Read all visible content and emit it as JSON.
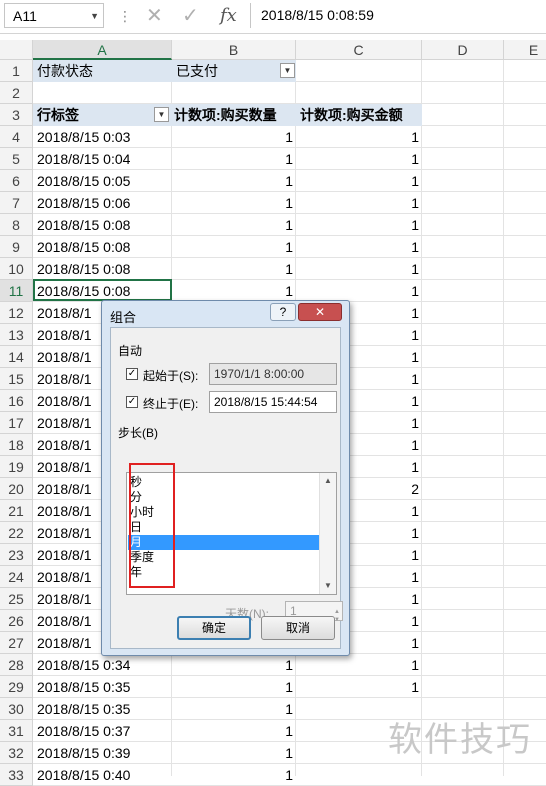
{
  "formula_bar": {
    "name_box": "A11",
    "formula": "2018/8/15  0:08:59",
    "fx_label": "fx",
    "cancel_icon": "✕",
    "enter_icon": "✓"
  },
  "columns": [
    "A",
    "B",
    "C",
    "D",
    "E"
  ],
  "pivot": {
    "filter_label": "付款状态",
    "filter_value": "已支付",
    "row_label": "行标签",
    "col_b_header": "计数项:购买数量",
    "col_c_header": "计数项:购买金额"
  },
  "rows": [
    {
      "n": "1"
    },
    {
      "n": "2"
    },
    {
      "n": "3"
    },
    {
      "n": "4",
      "a": "2018/8/15 0:03",
      "b": "1",
      "c": "1"
    },
    {
      "n": "5",
      "a": "2018/8/15 0:04",
      "b": "1",
      "c": "1"
    },
    {
      "n": "6",
      "a": "2018/8/15 0:05",
      "b": "1",
      "c": "1"
    },
    {
      "n": "7",
      "a": "2018/8/15 0:06",
      "b": "1",
      "c": "1"
    },
    {
      "n": "8",
      "a": "2018/8/15 0:08",
      "b": "1",
      "c": "1"
    },
    {
      "n": "9",
      "a": "2018/8/15 0:08",
      "b": "1",
      "c": "1"
    },
    {
      "n": "10",
      "a": "2018/8/15 0:08",
      "b": "1",
      "c": "1"
    },
    {
      "n": "11",
      "a": "2018/8/15 0:08",
      "b": "1",
      "c": "1"
    },
    {
      "n": "12",
      "a": "2018/8/1",
      "b": "",
      "c": "1"
    },
    {
      "n": "13",
      "a": "2018/8/1",
      "b": "",
      "c": "1"
    },
    {
      "n": "14",
      "a": "2018/8/1",
      "b": "",
      "c": "1"
    },
    {
      "n": "15",
      "a": "2018/8/1",
      "b": "",
      "c": "1"
    },
    {
      "n": "16",
      "a": "2018/8/1",
      "b": "",
      "c": "1"
    },
    {
      "n": "17",
      "a": "2018/8/1",
      "b": "",
      "c": "1"
    },
    {
      "n": "18",
      "a": "2018/8/1",
      "b": "",
      "c": "1"
    },
    {
      "n": "19",
      "a": "2018/8/1",
      "b": "",
      "c": "1"
    },
    {
      "n": "20",
      "a": "2018/8/1",
      "b": "",
      "c": "2"
    },
    {
      "n": "21",
      "a": "2018/8/1",
      "b": "",
      "c": "1"
    },
    {
      "n": "22",
      "a": "2018/8/1",
      "b": "",
      "c": "1"
    },
    {
      "n": "23",
      "a": "2018/8/1",
      "b": "",
      "c": "1"
    },
    {
      "n": "24",
      "a": "2018/8/1",
      "b": "",
      "c": "1"
    },
    {
      "n": "25",
      "a": "2018/8/1",
      "b": "",
      "c": "1"
    },
    {
      "n": "26",
      "a": "2018/8/1",
      "b": "",
      "c": "1"
    },
    {
      "n": "27",
      "a": "2018/8/1",
      "b": "",
      "c": "1"
    },
    {
      "n": "28",
      "a": "2018/8/15 0:34",
      "b": "1",
      "c": "1"
    },
    {
      "n": "29",
      "a": "2018/8/15 0:35",
      "b": "1",
      "c": "1"
    },
    {
      "n": "30",
      "a": "2018/8/15 0:35",
      "b": "1",
      "c": ""
    },
    {
      "n": "31",
      "a": "2018/8/15 0:37",
      "b": "1",
      "c": ""
    },
    {
      "n": "32",
      "a": "2018/8/15 0:39",
      "b": "1",
      "c": ""
    },
    {
      "n": "33",
      "a": "2018/8/15 0:40",
      "b": "1",
      "c": ""
    }
  ],
  "dialog": {
    "title": "组合",
    "help": "?",
    "close": "✕",
    "auto_label": "自动",
    "start_label": "起始于(S):",
    "start_value": "1970/1/1 8:00:00",
    "end_label": "终止于(E):",
    "end_value": "2018/8/15 15:44:54",
    "step_label": "步长(B)",
    "list_items": [
      "秒",
      "分",
      "小时",
      "日",
      "月",
      "季度",
      "年"
    ],
    "selected_index": 4,
    "days_label": "天数(N):",
    "days_value": "1",
    "ok": "确定",
    "cancel": "取消"
  },
  "watermark": "软件技巧"
}
